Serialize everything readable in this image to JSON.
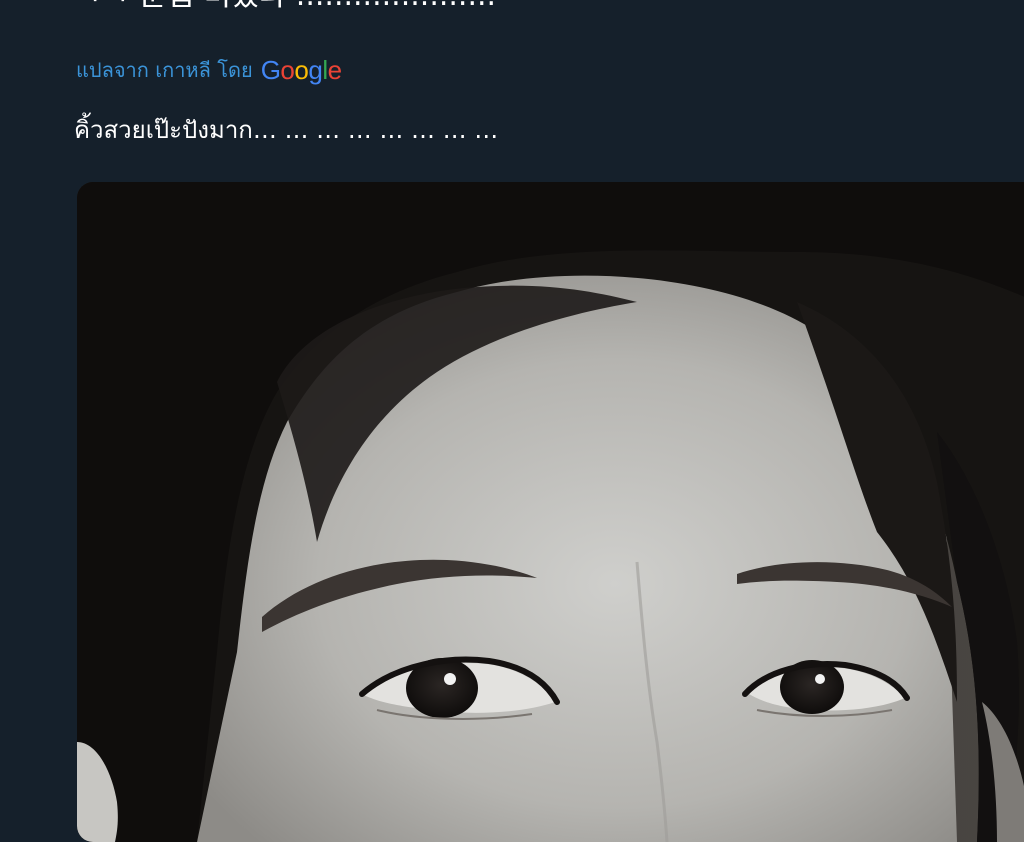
{
  "tweet": {
    "original_text_clipped": "ㅋㅋ 눈썹 미쳤다 ....................."
  },
  "translation": {
    "label": "แปลจาก เกาหลี โดย",
    "provider": "Google",
    "provider_letters": [
      {
        "char": "G",
        "color": "#4285F4"
      },
      {
        "char": "o",
        "color": "#EA4335"
      },
      {
        "char": "o",
        "color": "#FBBC05"
      },
      {
        "char": "g",
        "color": "#4285F4"
      },
      {
        "char": "l",
        "color": "#34A853"
      },
      {
        "char": "e",
        "color": "#EA4335"
      }
    ],
    "translated_text": "คิ้วสวยเป๊ะปังมาก… … … … … … … …"
  },
  "media": {
    "kind": "black-and-white close-up photo"
  },
  "colors": {
    "background": "#15202b",
    "link": "#3b94d9",
    "text": "#ffffff"
  }
}
